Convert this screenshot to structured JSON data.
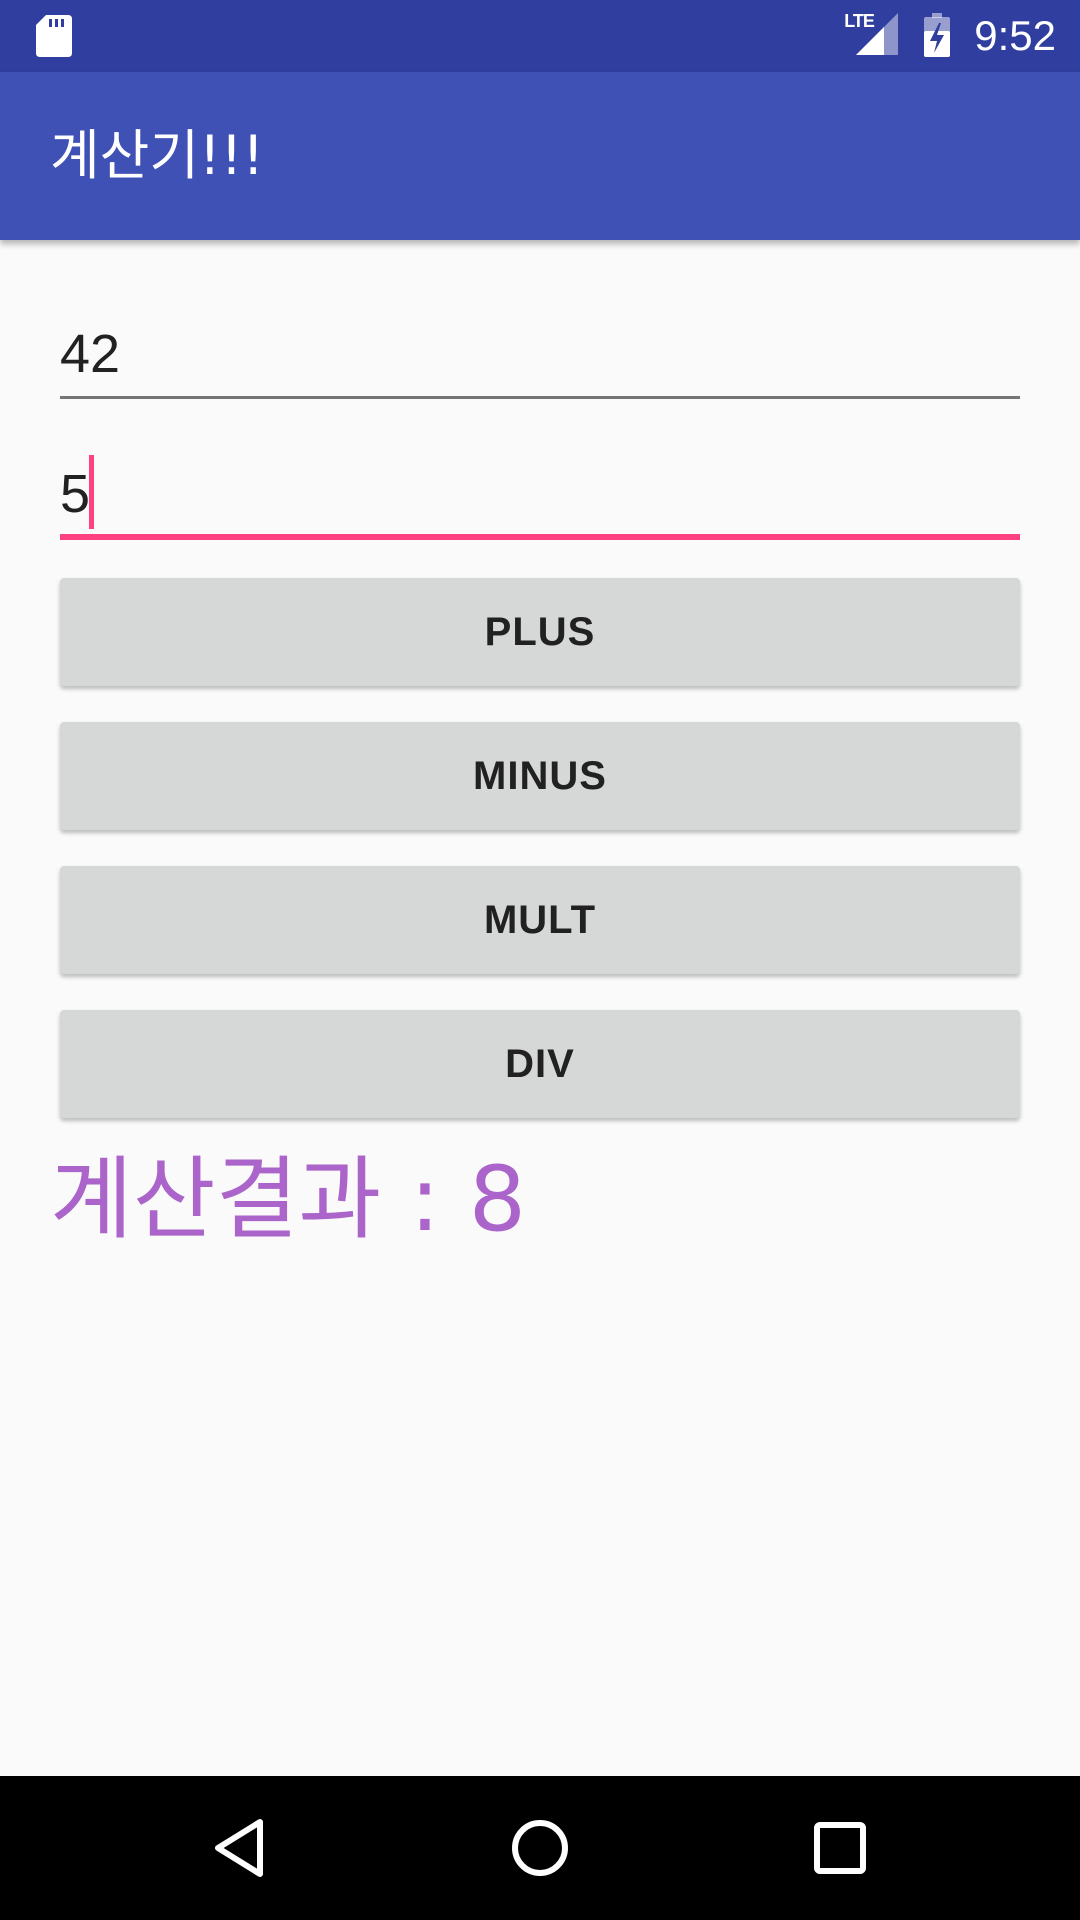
{
  "status_bar": {
    "time": "9:52",
    "network": "LTE",
    "icons": [
      "sd-card-icon",
      "lte-signal-icon",
      "battery-charging-icon"
    ],
    "background": "#303f9f"
  },
  "app_bar": {
    "title": "계산기!!!",
    "background": "#3f51b5"
  },
  "inputs": [
    {
      "value": "42",
      "focused": false
    },
    {
      "value": "5",
      "focused": true
    }
  ],
  "buttons": {
    "plus": "PLUS",
    "minus": "MINUS",
    "mult": "MULT",
    "div": "DIV"
  },
  "result": {
    "text": "계산결과 : 8",
    "color": "#ab64c9"
  },
  "nav_bar": {
    "icons": [
      "back-icon",
      "home-icon",
      "recents-icon"
    ]
  },
  "colors": {
    "accent": "#ff4081",
    "primary": "#3f51b5",
    "primary_dark": "#303f9f",
    "button": "#d6d7d7"
  }
}
